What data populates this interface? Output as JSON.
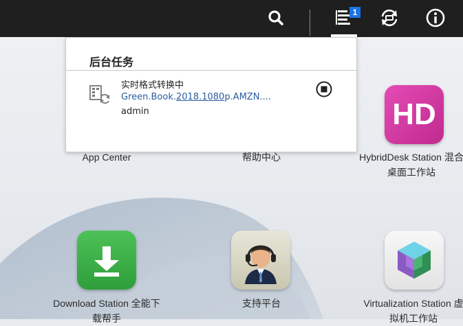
{
  "topbar": {
    "icons": [
      "search-icon",
      "background-tasks-icon",
      "sync-icon",
      "info-icon"
    ],
    "tasks_badge": "1"
  },
  "popup": {
    "title": "后台任务",
    "task": {
      "status": "实时格式转换中",
      "file_prefix": "Green.Book.",
      "file_link": "2018.1080",
      "file_suffix": "p.AMZN....",
      "user": "admin"
    }
  },
  "apps": {
    "app_center": {
      "label": "App Center"
    },
    "help_center": {
      "label": "帮助中心"
    },
    "hybriddesk": {
      "label_line1": "HybridDesk Station 混合",
      "label_line2": "桌面工作站",
      "icon_text": "HD"
    },
    "download_station": {
      "label_line1": "Download Station 全能下",
      "label_line2": "载帮手"
    },
    "support": {
      "label": "支持平台"
    },
    "virtualization": {
      "label_line1": "Virtualization Station 虚",
      "label_line2": "拟机工作站"
    }
  },
  "colors": {
    "topbar": "#1f1f1f",
    "badge": "#1a73e8",
    "link": "#2a5ba0",
    "hybriddesk": "#d63aa5",
    "download": "#3fb34a"
  }
}
